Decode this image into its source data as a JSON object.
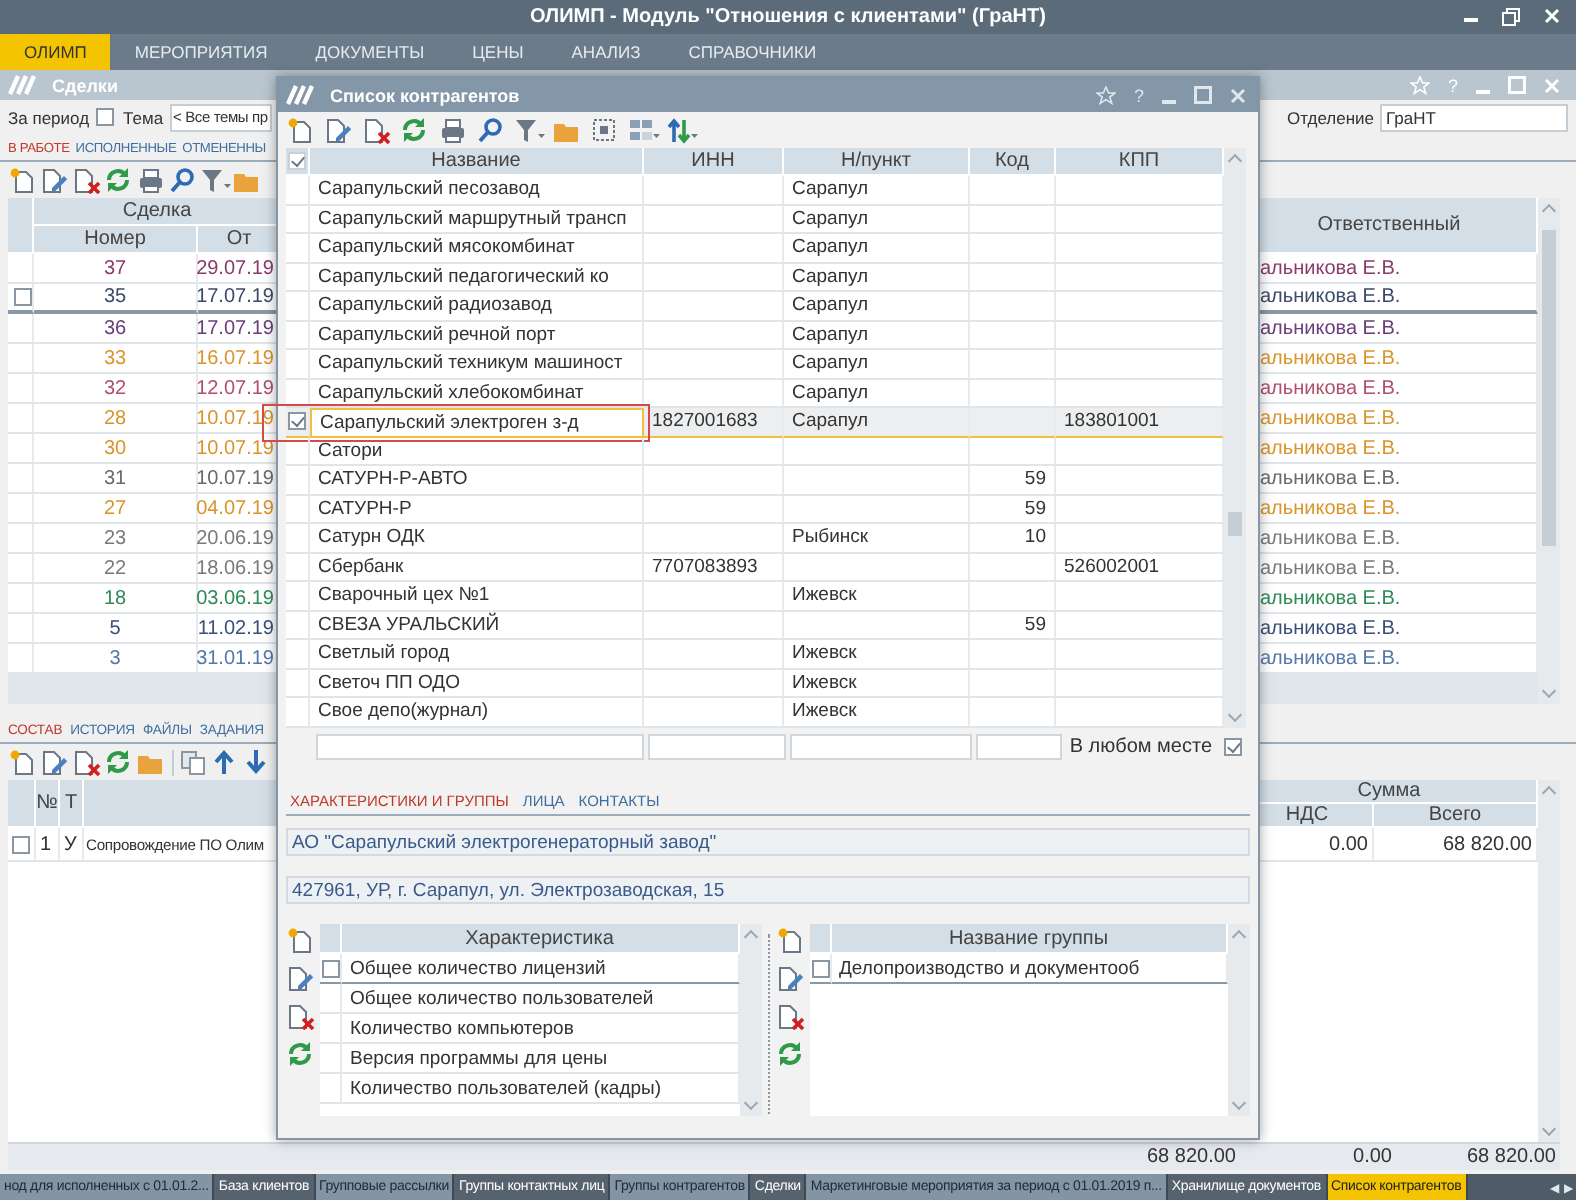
{
  "window": {
    "title": "ОЛИМП - Модуль \"Отношения с клиентами\" (ГраНТ)"
  },
  "menu": [
    {
      "label": "ОЛИМП",
      "selected": true
    },
    {
      "label": "МЕРОПРИЯТИЯ",
      "selected": false
    },
    {
      "label": "ДОКУМЕНТЫ",
      "selected": false
    },
    {
      "label": "ЦЕНЫ",
      "selected": false
    },
    {
      "label": "АНАЛИЗ",
      "selected": false
    },
    {
      "label": "СПРАВОЧНИКИ",
      "selected": false
    }
  ],
  "deals_window": {
    "title": "Сделки",
    "help": "?",
    "filters": {
      "period_label": "За период",
      "period_checked": false,
      "theme_label": "Тема",
      "theme_value": "< Все темы пр",
      "department_label": "Отделение",
      "department_value": "ГраНТ"
    },
    "tabs": [
      {
        "label": "В РАБОТЕ",
        "selected": true
      },
      {
        "label": "ИСПОЛНЕННЫЕ",
        "selected": false
      },
      {
        "label": "ОТМЕНЕННЫ",
        "selected": false
      }
    ],
    "table": {
      "group_header": "Сделка",
      "columns": [
        "Номер",
        "От",
        "Ответственный"
      ],
      "rows": [
        {
          "number": "37",
          "date": "29.07.19",
          "responsible": "альникова Е.В.",
          "color": "#8a3b6e",
          "selected": false
        },
        {
          "number": "35",
          "date": "17.07.19",
          "responsible": "альникова Е.В.",
          "color": "#3c4a6a",
          "selected": true
        },
        {
          "number": "36",
          "date": "17.07.19",
          "responsible": "альникова Е.В.",
          "color": "#6a3d7a",
          "selected": false
        },
        {
          "number": "33",
          "date": "16.07.19",
          "responsible": "альникова Е.В.",
          "color": "#d9952b",
          "selected": false
        },
        {
          "number": "32",
          "date": "12.07.19",
          "responsible": "альникова Е.В.",
          "color": "#b0506a",
          "selected": false
        },
        {
          "number": "28",
          "date": "10.07.19",
          "responsible": "альникова Е.В.",
          "color": "#d9952b",
          "selected": false
        },
        {
          "number": "30",
          "date": "10.07.19",
          "responsible": "альникова Е.В.",
          "color": "#d9952b",
          "selected": false
        },
        {
          "number": "31",
          "date": "10.07.19",
          "responsible": "альникова Е.В.",
          "color": "#6a6a6a",
          "selected": false
        },
        {
          "number": "27",
          "date": "04.07.19",
          "responsible": "альникова Е.В.",
          "color": "#d9952b",
          "selected": false
        },
        {
          "number": "23",
          "date": "20.06.19",
          "responsible": "альникова Е.В.",
          "color": "#7a7a7a",
          "selected": false
        },
        {
          "number": "22",
          "date": "18.06.19",
          "responsible": "альникова Е.В.",
          "color": "#7a7a7a",
          "selected": false
        },
        {
          "number": "18",
          "date": "03.06.19",
          "responsible": "альникова Е.В.",
          "color": "#2e8b57",
          "selected": false
        },
        {
          "number": "5",
          "date": "11.02.19",
          "responsible": "альникова Е.В.",
          "color": "#3a4f7a",
          "selected": false
        },
        {
          "number": "3",
          "date": "31.01.19",
          "responsible": "альникова Е.В.",
          "color": "#5577aa",
          "selected": false
        }
      ]
    },
    "detail_tabs": [
      {
        "label": "СОСТАВ",
        "selected": true
      },
      {
        "label": "ИСТОРИЯ",
        "selected": false
      },
      {
        "label": "ФАЙЛЫ",
        "selected": false
      },
      {
        "label": "ЗАДАНИЯ",
        "selected": false
      }
    ],
    "items_table": {
      "columns": [
        "№",
        "Т"
      ],
      "sum_header": "Сумма",
      "sum_columns": [
        "НДС",
        "Всего"
      ],
      "rows": [
        {
          "checked": false,
          "number": "1",
          "type": "У",
          "name": "Сопровождение ПО Олим",
          "vat": "0.00",
          "total": "68 820.00"
        }
      ]
    },
    "totals": [
      "68 820.00",
      "0.00",
      "68 820.00"
    ]
  },
  "dialog": {
    "title": "Список контрагентов",
    "help": "?",
    "table": {
      "header_checked": true,
      "columns": [
        "Название",
        "ИНН",
        "Н/пункт",
        "Код",
        "КПП"
      ],
      "rows": [
        {
          "name": "Сарапульский песозавод",
          "city": "Сарапул",
          "selected": false
        },
        {
          "name": "Сарапульский маршрутный трансп",
          "city": "Сарапул",
          "selected": false
        },
        {
          "name": "Сарапульский мясокомбинат",
          "city": "Сарапул",
          "selected": false
        },
        {
          "name": "Сарапульский педагогический ко",
          "city": "Сарапул",
          "selected": false
        },
        {
          "name": "Сарапульский радиозавод",
          "city": "Сарапул",
          "selected": false
        },
        {
          "name": "Сарапульский речной порт",
          "city": "Сарапул",
          "selected": false
        },
        {
          "name": "Сарапульский техникум машиност",
          "city": "Сарапул",
          "selected": false
        },
        {
          "name": "Сарапульский хлебокомбинат",
          "city": "Сарапул",
          "selected": false
        },
        {
          "name": "Сарапульский электроген з-д",
          "inn": "1827001683",
          "city": "Сарапул",
          "kpp": "183801001",
          "selected": true
        },
        {
          "name": "Сатори",
          "selected": false
        },
        {
          "name": "САТУРН-Р-АВТО",
          "code": "59",
          "selected": false
        },
        {
          "name": "САТУРН-Р",
          "code": "59",
          "selected": false
        },
        {
          "name": "Сатурн ОДК",
          "city": "Рыбинск",
          "code": "10",
          "selected": false
        },
        {
          "name": "Сбербанк",
          "inn": "7707083893",
          "kpp": "526002001",
          "selected": false
        },
        {
          "name": "Сварочный цех №1",
          "city": "Ижевск",
          "selected": false
        },
        {
          "name": "СВЕЗА УРАЛЬСКИЙ",
          "code": "59",
          "selected": false
        },
        {
          "name": "Светлый город",
          "city": "Ижевск",
          "selected": false
        },
        {
          "name": "Светоч  ПП  ОДО",
          "city": "Ижевск",
          "selected": false
        },
        {
          "name": "Свое депо(журнал)",
          "city": "Ижевск",
          "selected": false
        }
      ]
    },
    "anywhere": {
      "label": "В любом месте",
      "checked": true
    },
    "tabs": [
      {
        "label": "ХАРАКТЕРИСТИКИ И ГРУППЫ",
        "selected": true
      },
      {
        "label": "ЛИЦА",
        "selected": false
      },
      {
        "label": "КОНТАКТЫ",
        "selected": false
      }
    ],
    "full_name": "АО \"Сарапульский электрогенераторный завод\"",
    "address": "427961, УР, г. Сарапул, ул. Электрозаводская, 15",
    "characteristics": {
      "column": "Характеристика",
      "rows": [
        {
          "label": "Общее количество лицензий",
          "selected": true
        },
        {
          "label": "Общее количество пользователей",
          "selected": false
        },
        {
          "label": "Количество компьютеров",
          "selected": false
        },
        {
          "label": "Версия программы для цены",
          "selected": false
        },
        {
          "label": "Количество пользователей (кадры)",
          "selected": false
        }
      ]
    },
    "groups": {
      "column": "Название группы",
      "rows": [
        {
          "label": "Делопроизводство и документооб",
          "selected": true
        }
      ]
    }
  },
  "taskbar": [
    {
      "label": "нод для исполненных с 01.01.2...",
      "selected": false
    },
    {
      "label": "База клиентов",
      "selected": false
    },
    {
      "label": "Групповые рассылки",
      "selected": false
    },
    {
      "label": "Группы контактных лиц",
      "selected": false
    },
    {
      "label": "Группы контрагентов",
      "selected": false
    },
    {
      "label": "Сделки",
      "selected": false
    },
    {
      "label": "Маркетинговые мероприятия за период с 01.01.2019 п...",
      "selected": false
    },
    {
      "label": "Хранилище документов",
      "selected": false
    },
    {
      "label": "Список контрагентов",
      "selected": true
    }
  ],
  "taskbar_arrows": [
    "◀",
    "▶"
  ]
}
